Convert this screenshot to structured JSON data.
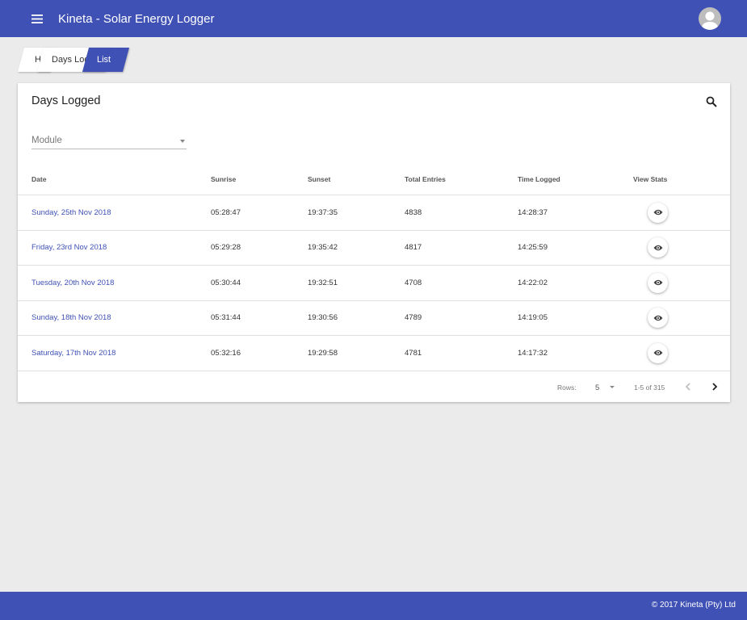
{
  "app": {
    "title": "Kineta - Solar Energy Logger",
    "accent": "#3f51b5"
  },
  "icons": {
    "menu": "menu-icon",
    "avatar": "account-icon",
    "search": "search-icon",
    "view": "eye-icon",
    "prev": "chevron-left-icon",
    "next": "chevron-right-icon"
  },
  "breadcrumb": {
    "home": "H",
    "days": "Days Logged",
    "list": "List"
  },
  "card": {
    "title": "Days Logged",
    "module_label": "Module"
  },
  "table": {
    "headers": {
      "date": "Date",
      "sunrise": "Sunrise",
      "sunset": "Sunset",
      "total": "Total Entries",
      "time": "Time Logged",
      "view": "View Stats"
    },
    "rows": [
      {
        "date": "Sunday, 25th Nov 2018",
        "sunrise": "05:28:47",
        "sunset": "19:37:35",
        "total": "4838",
        "time": "14:28:37"
      },
      {
        "date": "Friday, 23rd Nov 2018",
        "sunrise": "05:29:28",
        "sunset": "19:35:42",
        "total": "4817",
        "time": "14:25:59"
      },
      {
        "date": "Tuesday, 20th Nov 2018",
        "sunrise": "05:30:44",
        "sunset": "19:32:51",
        "total": "4708",
        "time": "14:22:02"
      },
      {
        "date": "Sunday, 18th Nov 2018",
        "sunrise": "05:31:44",
        "sunset": "19:30:56",
        "total": "4789",
        "time": "14:19:05"
      },
      {
        "date": "Saturday, 17th Nov 2018",
        "sunrise": "05:32:16",
        "sunset": "19:29:58",
        "total": "4781",
        "time": "14:17:32"
      }
    ]
  },
  "pagination": {
    "rows_label": "Rows:",
    "rows_value": "5",
    "range": "1-5 of 315"
  },
  "footer": {
    "copyright": "© 2017 Kineta (Pty) Ltd"
  }
}
